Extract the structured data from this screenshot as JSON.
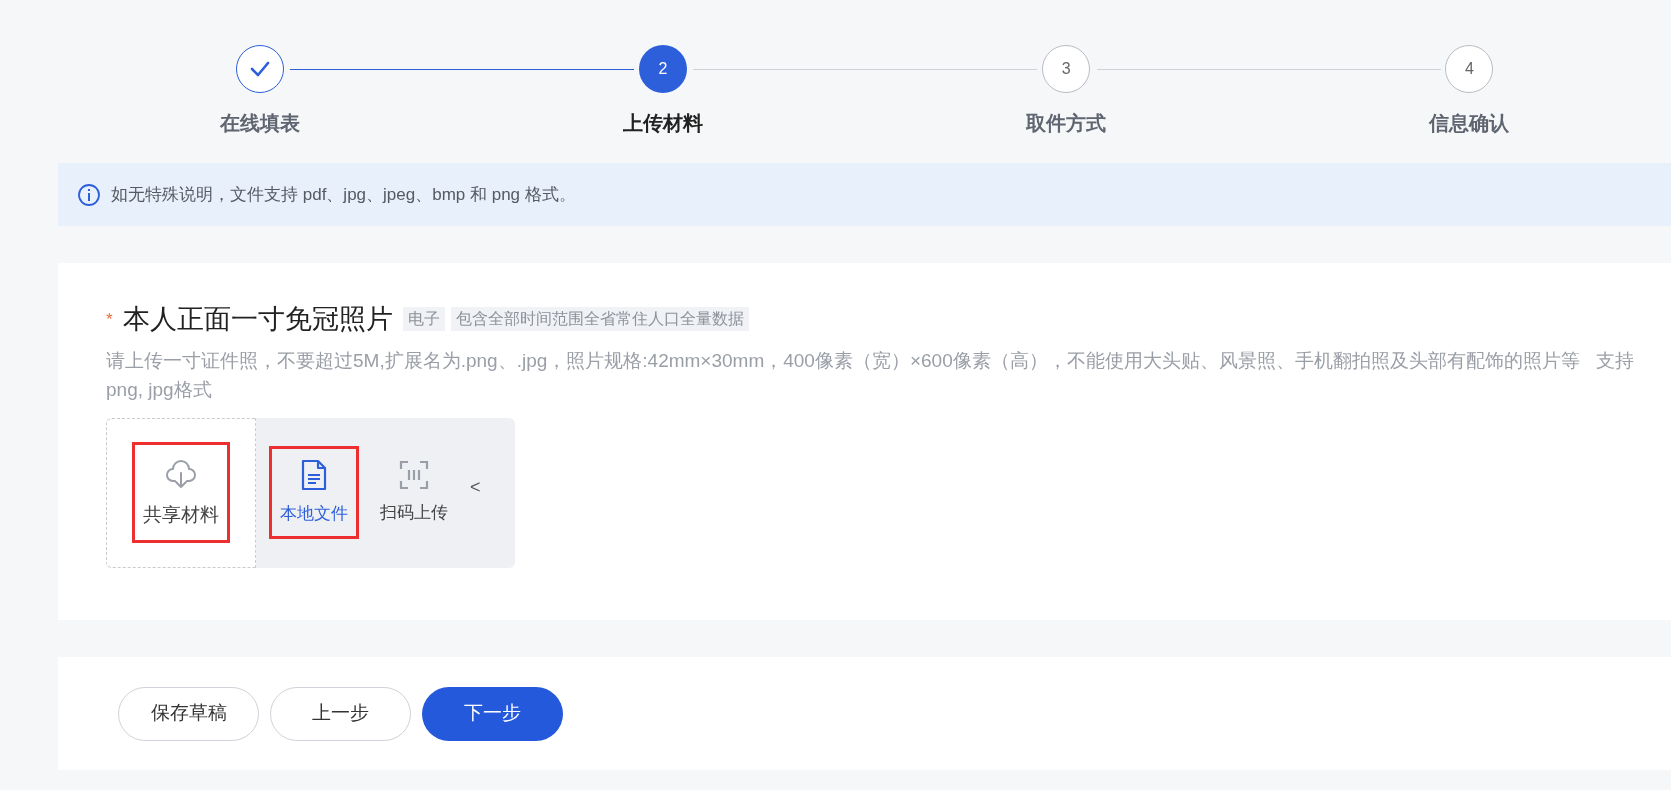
{
  "steps": [
    {
      "label": "在线填表",
      "completed": true,
      "selected": false
    },
    {
      "number": "2",
      "label": "上传材料",
      "completed": false,
      "selected": true
    },
    {
      "number": "3",
      "label": "取件方式",
      "completed": false,
      "selected": false
    },
    {
      "number": "4",
      "label": "信息确认",
      "completed": false,
      "selected": false
    }
  ],
  "notice": {
    "text": "如无特殊说明，文件支持 pdf、jpg、jpeg、bmp 和 png 格式。"
  },
  "material": {
    "required_mark": "*",
    "title": "本人正面一寸免冠照片",
    "tags": [
      "电子",
      "包含全部时间范围全省常住人口全量数据"
    ],
    "description": "请上传一寸证件照，不要超过5M,扩展名为.png、.jpg，照片规格:42mm×30mm，400像素（宽）×600像素（高），不能使用大头贴、风景照、手机翻拍照及头部有配饰的照片等   支持 png, jpg格式",
    "upload_options": [
      {
        "kind": "shared",
        "label": "共享材料",
        "selected": false,
        "highlighted": true
      },
      {
        "kind": "local",
        "label": "本地文件",
        "selected": true,
        "highlighted": true
      },
      {
        "kind": "scan",
        "label": "扫码上传",
        "selected": false,
        "highlighted": false
      }
    ],
    "collapse": "<"
  },
  "buttons": [
    {
      "label": "保存草稿",
      "primary": false
    },
    {
      "label": "上一步",
      "primary": false
    },
    {
      "label": "下一步",
      "primary": true
    }
  ]
}
